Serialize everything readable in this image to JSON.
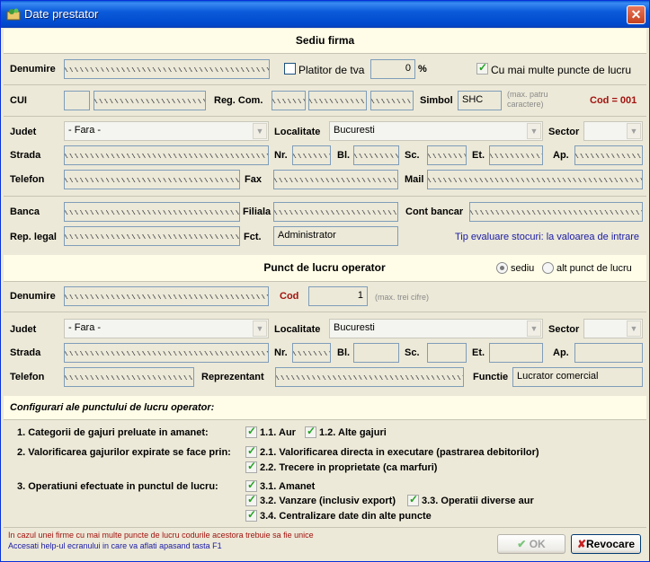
{
  "window": {
    "title": "Date prestator"
  },
  "sediu": {
    "header": "Sediu firma",
    "denumire_label": "Denumire",
    "platitor_label": "Platitor de tva",
    "tva_value": "0",
    "tva_unit": "%",
    "multe_label": "Cu mai multe puncte de lucru",
    "cui_label": "CUI",
    "regcom_label": "Reg. Com.",
    "simbol_label": "Simbol",
    "simbol_value": "SHC",
    "simbol_hint": "(max. patru caractere)",
    "cod_text": "Cod = 001",
    "judet_label": "Judet",
    "judet_value": "- Fara -",
    "localitate_label": "Localitate",
    "localitate_value": "Bucuresti",
    "sector_label": "Sector",
    "strada_label": "Strada",
    "nr_label": "Nr.",
    "bl_label": "Bl.",
    "sc_label": "Sc.",
    "et_label": "Et.",
    "ap_label": "Ap.",
    "telefon_label": "Telefon",
    "fax_label": "Fax",
    "mail_label": "Mail",
    "banca_label": "Banca",
    "filiala_label": "Filiala",
    "cont_label": "Cont bancar",
    "rep_label": "Rep. legal",
    "fct_label": "Fct.",
    "fct_value": "Administrator",
    "tip_text": "Tip evaluare stocuri: la valoarea de intrare"
  },
  "punct": {
    "header": "Punct de lucru operator",
    "radio_sediu": "sediu",
    "radio_alt": "alt punct de lucru",
    "denumire_label": "Denumire",
    "cod_label": "Cod",
    "cod_value": "1",
    "cod_hint": "(max. trei cifre)",
    "judet_label": "Judet",
    "judet_value": "- Fara -",
    "localitate_label": "Localitate",
    "localitate_value": "Bucuresti",
    "sector_label": "Sector",
    "strada_label": "Strada",
    "nr_label": "Nr.",
    "bl_label": "Bl.",
    "sc_label": "Sc.",
    "et_label": "Et.",
    "ap_label": "Ap.",
    "telefon_label": "Telefon",
    "reprezentant_label": "Reprezentant",
    "functie_label": "Functie",
    "functie_value": "Lucrator comercial"
  },
  "config": {
    "header": "Configurari ale punctului de lucru operator:",
    "q1": "1. Categorii de gajuri preluate in amanet:",
    "q1a": "1.1. Aur",
    "q1b": "1.2. Alte gajuri",
    "q2": "2. Valorificarea gajurilor expirate se face prin:",
    "q2a": "2.1. Valorificarea directa in executare (pastrarea debitorilor)",
    "q2b": "2.2. Trecere in proprietate (ca marfuri)",
    "q3": "3. Operatiuni efectuate in punctul de lucru:",
    "q3a": "3.1. Amanet",
    "q3b": "3.2. Vanzare (inclusiv export)",
    "q3c": "3.3. Operatii diverse aur",
    "q3d": "3.4. Centralizare date din alte puncte"
  },
  "footer": {
    "note_red": "In cazul unei firme cu mai multe puncte de lucru codurile acestora trebuie sa fie unice",
    "note_blue": "Accesati help-ul ecranului in care va aflati apasand tasta F1",
    "ok_label": "OK",
    "revocare_label": "Revocare"
  },
  "colors": {
    "title_bar": "#0054e3",
    "band": "#fffde8",
    "red_text": "#a3130f",
    "blue_text": "#1a1aa6",
    "check": "#21a121"
  }
}
